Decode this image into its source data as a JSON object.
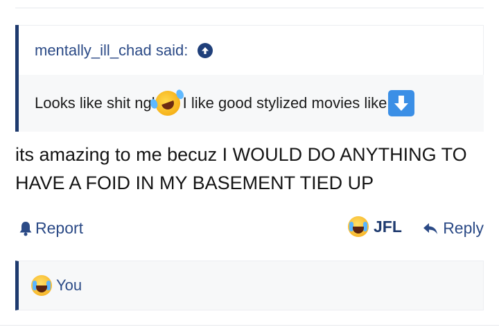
{
  "quote": {
    "author": "mentally_ill_chad said:",
    "text_before": "Looks like shit ngl",
    "text_after": " I like good stylized movies like",
    "icons": [
      "up-arrow-circle-icon",
      "rolling-laughing-emoji-icon",
      "down-arrow-emoji-icon"
    ]
  },
  "post": {
    "text": "its amazing to me becuz I WOULD DO ANYTHING TO HAVE A FOID IN MY BASEMENT TIED UP"
  },
  "actions": {
    "report_label": "Report",
    "reaction_label": "JFL",
    "reply_label": "Reply"
  },
  "reactions": {
    "summary_label": "You"
  },
  "colors": {
    "accent": "#2b4a86",
    "quote_border": "#1e3a6e",
    "quote_bg": "#f7f8f9",
    "divider": "#e6e8ec"
  }
}
